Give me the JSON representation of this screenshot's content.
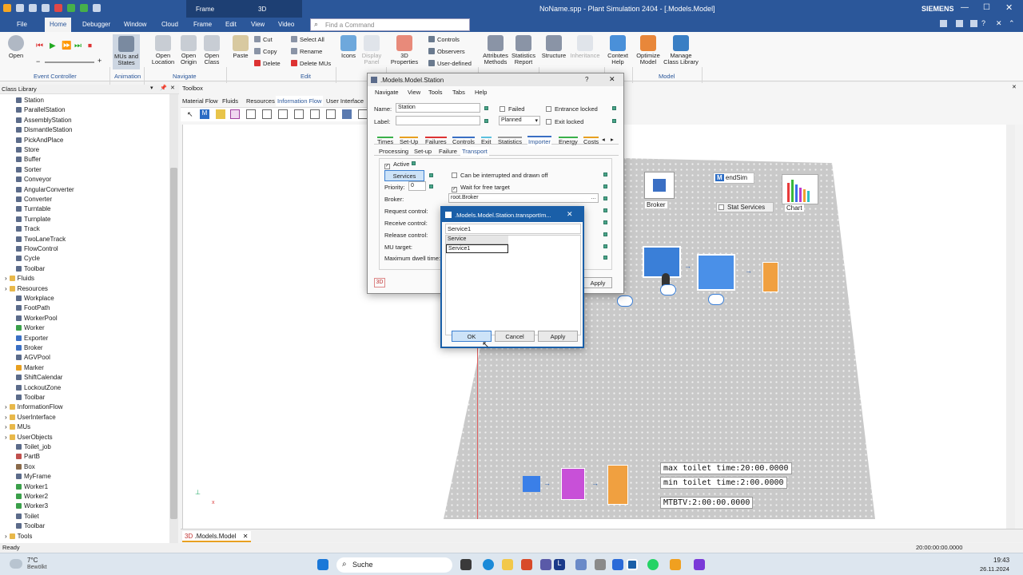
{
  "window": {
    "title": "NoName.spp - Plant Simulation 2404 - [.Models.Model]",
    "brand": "SIEMENS",
    "context_group": "Frame",
    "context_sub": "3D"
  },
  "ribbon_tabs": [
    "File",
    "Home",
    "Debugger",
    "Window",
    "Cloud",
    "Frame",
    "Edit",
    "View",
    "Video"
  ],
  "search_placeholder": "Find a Command",
  "ribbon": {
    "open": "Open",
    "mus_states": "MUs and\nStates",
    "open_location": "Open\nLocation",
    "open_origin": "Open\nOrigin",
    "open_class": "Open\nClass",
    "paste": "Paste",
    "cut": "Cut",
    "copy": "Copy",
    "delete": "Delete",
    "select_all": "Select All",
    "rename": "Rename",
    "delete_mus": "Delete MUs",
    "icons": "Icons",
    "display_panel": "Display\nPanel",
    "properties_3d": "3D\nProperties",
    "controls": "Controls",
    "observers": "Observers",
    "user_defined": "User-defined",
    "attributes_methods": "Attributes\nMethods",
    "statistics_report": "Statistics\nReport",
    "structure": "Structure",
    "inheritance": "Inheritance",
    "context_help": "Context\nHelp",
    "optimize_model": "Optimize\nModel",
    "manage_class_library": "Manage\nClass Library",
    "groups": {
      "event_controller": "Event Controller",
      "animation": "Animation",
      "navigate": "Navigate",
      "edit": "Edit",
      "model": "Model"
    }
  },
  "class_library": {
    "title": "Class Library",
    "items": [
      {
        "label": "Station",
        "level": 2,
        "icon": "#5b6b8a"
      },
      {
        "label": "ParallelStation",
        "level": 2,
        "icon": "#5b6b8a"
      },
      {
        "label": "AssemblyStation",
        "level": 2,
        "icon": "#5b6b8a"
      },
      {
        "label": "DismantleStation",
        "level": 2,
        "icon": "#5b6b8a"
      },
      {
        "label": "PickAndPlace",
        "level": 2,
        "icon": "#5b6b8a"
      },
      {
        "label": "Store",
        "level": 2,
        "icon": "#5b6b8a"
      },
      {
        "label": "Buffer",
        "level": 2,
        "icon": "#5b6b8a"
      },
      {
        "label": "Sorter",
        "level": 2,
        "icon": "#5b6b8a"
      },
      {
        "label": "Conveyor",
        "level": 2,
        "icon": "#5b6b8a"
      },
      {
        "label": "AngularConverter",
        "level": 2,
        "icon": "#5b6b8a"
      },
      {
        "label": "Converter",
        "level": 2,
        "icon": "#5b6b8a"
      },
      {
        "label": "Turntable",
        "level": 2,
        "icon": "#5b6b8a"
      },
      {
        "label": "Turnplate",
        "level": 2,
        "icon": "#5b6b8a"
      },
      {
        "label": "Track",
        "level": 2,
        "icon": "#5b6b8a"
      },
      {
        "label": "TwoLaneTrack",
        "level": 2,
        "icon": "#5b6b8a"
      },
      {
        "label": "FlowControl",
        "level": 2,
        "icon": "#5b6b8a"
      },
      {
        "label": "Cycle",
        "level": 2,
        "icon": "#5b6b8a"
      },
      {
        "label": "Toolbar",
        "level": 2,
        "icon": "#5b6b8a"
      },
      {
        "label": "Fluids",
        "level": 1,
        "icon": "#e8b84a"
      },
      {
        "label": "Resources",
        "level": 1,
        "icon": "#e8b84a"
      },
      {
        "label": "Workplace",
        "level": 2,
        "icon": "#5b6b8a"
      },
      {
        "label": "FootPath",
        "level": 2,
        "icon": "#5b6b8a"
      },
      {
        "label": "WorkerPool",
        "level": 2,
        "icon": "#5b6b8a"
      },
      {
        "label": "Worker",
        "level": 2,
        "icon": "#3aa04a"
      },
      {
        "label": "Exporter",
        "level": 2,
        "icon": "#3a6fc4"
      },
      {
        "label": "Broker",
        "level": 2,
        "icon": "#3a6fc4"
      },
      {
        "label": "AGVPool",
        "level": 2,
        "icon": "#5b6b8a"
      },
      {
        "label": "Marker",
        "level": 2,
        "icon": "#e8a020"
      },
      {
        "label": "ShiftCalendar",
        "level": 2,
        "icon": "#5b6b8a"
      },
      {
        "label": "LockoutZone",
        "level": 2,
        "icon": "#5b6b8a"
      },
      {
        "label": "Toolbar",
        "level": 2,
        "icon": "#5b6b8a"
      },
      {
        "label": "InformationFlow",
        "level": 1,
        "icon": "#e8b84a"
      },
      {
        "label": "UserInterface",
        "level": 1,
        "icon": "#e8b84a"
      },
      {
        "label": "MUs",
        "level": 1,
        "icon": "#e8b84a"
      },
      {
        "label": "UserObjects",
        "level": 1,
        "icon": "#e8b84a"
      },
      {
        "label": "Toilet_job",
        "level": 2,
        "icon": "#5b6b8a"
      },
      {
        "label": "PartB",
        "level": 2,
        "icon": "#c0504d"
      },
      {
        "label": "Box",
        "level": 2,
        "icon": "#8a6a4a"
      },
      {
        "label": "MyFrame",
        "level": 2,
        "icon": "#5b6b8a"
      },
      {
        "label": "Worker1",
        "level": 2,
        "icon": "#3aa04a"
      },
      {
        "label": "Worker2",
        "level": 2,
        "icon": "#3aa04a"
      },
      {
        "label": "Worker3",
        "level": 2,
        "icon": "#3aa04a"
      },
      {
        "label": "Toilet",
        "level": 2,
        "icon": "#5b6b8a"
      },
      {
        "label": "Toolbar",
        "level": 2,
        "icon": "#5b6b8a"
      },
      {
        "label": "Tools",
        "level": 1,
        "icon": "#e8b84a"
      }
    ]
  },
  "toolbox": {
    "title": "Toolbox",
    "tabs": [
      "Material Flow",
      "Fluids",
      "Resources",
      "Information Flow",
      "User Interface"
    ]
  },
  "station_dialog": {
    "title": ".Models.Model.Station",
    "menu": [
      "Navigate",
      "View",
      "Tools",
      "Tabs",
      "Help"
    ],
    "name_label": "Name:",
    "name_value": "Station",
    "label_label": "Label:",
    "label_value": "",
    "failed": "Failed",
    "entrance_locked": "Entrance locked",
    "planned": "Planned",
    "exit_locked": "Exit locked",
    "tabs": [
      "Times",
      "Set-Up",
      "Failures",
      "Controls",
      "Exit",
      "Statistics",
      "Importer",
      "Energy",
      "Costs"
    ],
    "subtabs": [
      "Processing",
      "Set-up",
      "Failure",
      "Transport"
    ],
    "active": "Active",
    "services_btn": "Services",
    "can_interrupt": "Can be interrupted and drawn off",
    "priority_label": "Priority:",
    "priority_value": "0",
    "wait_free": "Wait for free target",
    "broker_label": "Broker:",
    "broker_value": "root.Broker",
    "request_control": "Request control:",
    "receive_control": "Receive control:",
    "release_control": "Release control:",
    "mu_target": "MU target:",
    "max_dwell": "Maximum dwell time:",
    "apply": "Apply",
    "help_q": "?"
  },
  "transport_dialog": {
    "title": ".Models.Model.Station.transportIm...",
    "header_value": "Service1",
    "column": "Service",
    "rows": [
      "Service1"
    ],
    "ok": "OK",
    "cancel": "Cancel",
    "apply": "Apply"
  },
  "model": {
    "broker_label": "Broker",
    "endsim_label": "endSim",
    "chart_label": "Chart",
    "stat_services": "Stat Services",
    "max_toilet_label": "max toilet time:",
    "max_toilet_value": "20:00.0000",
    "min_toilet_label": "min toilet time:",
    "min_toilet_value": "2:00.0000",
    "mtbtv_label": "MTBTV:",
    "mtbtv_value": "2:00:00.0000"
  },
  "doc_tab": ".Models.Model",
  "status": {
    "left": "Ready",
    "time": "20:00:00:00.0000"
  },
  "taskbar": {
    "weather_temp": "7°C",
    "weather_desc": "Bewölkt",
    "search": "Suche",
    "clock": "19:43",
    "date": "26.11.2024"
  }
}
